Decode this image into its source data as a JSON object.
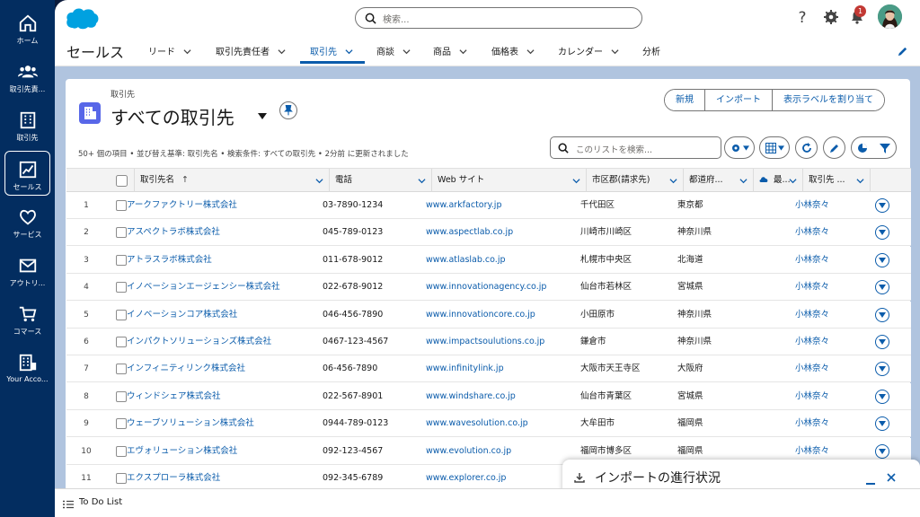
{
  "rail": [
    {
      "label": "ホーム",
      "icon": "home-icon"
    },
    {
      "label": "取引先責...",
      "icon": "contacts-icon"
    },
    {
      "label": "取引先",
      "icon": "accounts-icon"
    },
    {
      "label": "セールス",
      "icon": "sales-icon"
    },
    {
      "label": "サービス",
      "icon": "service-icon"
    },
    {
      "label": "アウトリ...",
      "icon": "outreach-icon"
    },
    {
      "label": "コマース",
      "icon": "commerce-icon"
    },
    {
      "label": "Your Acco...",
      "icon": "your-account-icon"
    }
  ],
  "header": {
    "search_placeholder": "検索...",
    "notification_count": "1"
  },
  "nav": {
    "app_name": "セールス",
    "items": [
      "リード",
      "取引先責任者",
      "取引先",
      "商談",
      "商品",
      "価格表",
      "カレンダー",
      "分析"
    ],
    "active_index": 2
  },
  "list": {
    "breadcrumb": "取引先",
    "title": "すべての取引先",
    "buttons": [
      "新規",
      "インポート",
      "表示ラベルを割り当て"
    ],
    "meta": "50+ 個の項目 • 並び替え基準: 取引先名 • 検索条件: すべての取引先 • 2分前 に更新されました",
    "search_placeholder": "このリストを検索..."
  },
  "table": {
    "headers": [
      "取引先名",
      "電話",
      "Web サイト",
      "市区郡(請求先)",
      "都道府...",
      "最...",
      "取引先 ..."
    ],
    "sort_arrow": "↑",
    "rows": [
      {
        "n": "1",
        "name": "アークファクトリー株式会社",
        "phone": "03-7890-1234",
        "web": "www.arkfactory.jp",
        "city": "千代田区",
        "pref": "東京都",
        "owner": "小林奈々"
      },
      {
        "n": "2",
        "name": "アスペクトラボ株式会社",
        "phone": "045-789-0123",
        "web": "www.aspectlab.co.jp",
        "city": "川崎市川崎区",
        "pref": "神奈川県",
        "owner": "小林奈々"
      },
      {
        "n": "3",
        "name": "アトラスラボ株式会社",
        "phone": "011-678-9012",
        "web": "www.atlaslab.co.jp",
        "city": "札幌市中央区",
        "pref": "北海道",
        "owner": "小林奈々"
      },
      {
        "n": "4",
        "name": "イノベーションエージェンシー株式会社",
        "phone": "022-678-9012",
        "web": "www.innovationagency.co.jp",
        "city": "仙台市若林区",
        "pref": "宮城県",
        "owner": "小林奈々"
      },
      {
        "n": "5",
        "name": "イノベーションコア株式会社",
        "phone": "046-456-7890",
        "web": "www.innovationcore.co.jp",
        "city": "小田原市",
        "pref": "神奈川県",
        "owner": "小林奈々"
      },
      {
        "n": "6",
        "name": "インパクトソリューションズ株式会社",
        "phone": "0467-123-4567",
        "web": "www.impactsoulutions.co.jp",
        "city": "鎌倉市",
        "pref": "神奈川県",
        "owner": "小林奈々"
      },
      {
        "n": "7",
        "name": "インフィニティリンク株式会社",
        "phone": "06-456-7890",
        "web": "www.infinitylink.jp",
        "city": "大阪市天王寺区",
        "pref": "大阪府",
        "owner": "小林奈々"
      },
      {
        "n": "8",
        "name": "ウィンドシェア株式会社",
        "phone": "022-567-8901",
        "web": "www.windshare.co.jp",
        "city": "仙台市青葉区",
        "pref": "宮城県",
        "owner": "小林奈々"
      },
      {
        "n": "9",
        "name": "ウェーブソリューション株式会社",
        "phone": "0944-789-0123",
        "web": "www.wavesolution.co.jp",
        "city": "大牟田市",
        "pref": "福岡県",
        "owner": "小林奈々"
      },
      {
        "n": "10",
        "name": "エヴォリューション株式会社",
        "phone": "092-123-4567",
        "web": "www.evolution.co.jp",
        "city": "福岡市博多区",
        "pref": "福岡県",
        "owner": "小林奈々"
      },
      {
        "n": "11",
        "name": "エクスプローラ株式会社",
        "phone": "092-345-6789",
        "web": "www.explorer.co.jp",
        "city": "",
        "pref": "",
        "owner": ""
      }
    ]
  },
  "import_panel": {
    "title": "インポートの進行状況"
  },
  "footer": {
    "label": "To Do List"
  },
  "colors": {
    "brand": "#0b5cab",
    "rail": "#032d60",
    "page_bg": "#b0c4df"
  }
}
